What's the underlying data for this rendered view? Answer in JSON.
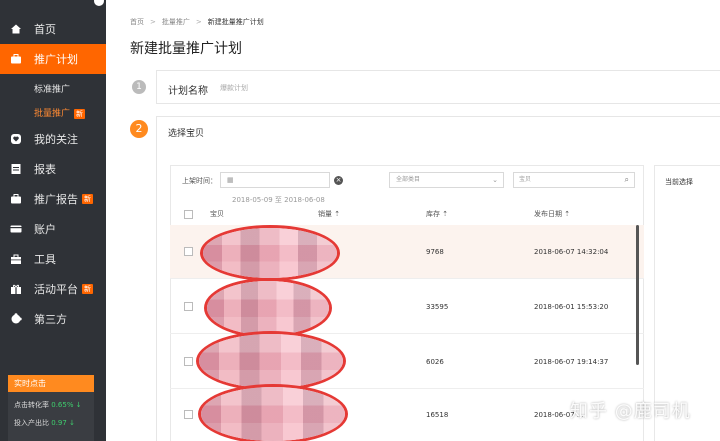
{
  "sidebar": {
    "items": [
      {
        "label": "首页",
        "icon": "home-icon"
      },
      {
        "label": "推广计划",
        "icon": "briefcase-icon"
      },
      {
        "label": "我的关注",
        "icon": "heart-icon"
      },
      {
        "label": "报表",
        "icon": "report-icon"
      },
      {
        "label": "推广报告",
        "icon": "briefcase-icon",
        "badge": "新"
      },
      {
        "label": "账户",
        "icon": "card-icon"
      },
      {
        "label": "工具",
        "icon": "toolbox-icon"
      },
      {
        "label": "活动平台",
        "icon": "gift-icon",
        "badge": "新"
      },
      {
        "label": "第三方",
        "icon": "puzzle-icon"
      }
    ],
    "sub_items": [
      {
        "label": "标准推广"
      },
      {
        "label": "批量推广",
        "badge": "新"
      }
    ],
    "realtime": {
      "title": "实时点击",
      "rows": [
        {
          "label": "点击转化率",
          "value": "0.65%",
          "trend": "↓"
        },
        {
          "label": "投入产出比",
          "value": "0.97",
          "trend": "↓"
        }
      ]
    }
  },
  "breadcrumb": {
    "home": "首页",
    "parent": "批量推广",
    "current": "新建批量推广计划"
  },
  "page_title": "新建批量推广计划",
  "step1": {
    "num": "1",
    "label": "计划名称",
    "placeholder": "爆款计划"
  },
  "step2": {
    "num": "2",
    "label": "选择宝贝"
  },
  "filters": {
    "time_label": "上架时间：",
    "date_icon": "calendar-icon",
    "date_range": "2018-05-09 至 2018-06-08",
    "category_placeholder": "全部类目",
    "search_placeholder": "宝贝"
  },
  "table": {
    "headers": {
      "item": "宝贝",
      "sales": "销量",
      "stock": "库存",
      "date": "发布日期"
    },
    "rows": [
      {
        "stock": "9768",
        "date": "2018-06-07 14:32:04"
      },
      {
        "stock": "33595",
        "date": "2018-06-01 15:53:20"
      },
      {
        "stock": "6026",
        "date": "2018-06-07 19:14:37"
      },
      {
        "stock": "16518",
        "date": "2018-06-07 ..."
      }
    ]
  },
  "right_panel_title": "当前选择",
  "watermark": "知乎 @鹿司机"
}
